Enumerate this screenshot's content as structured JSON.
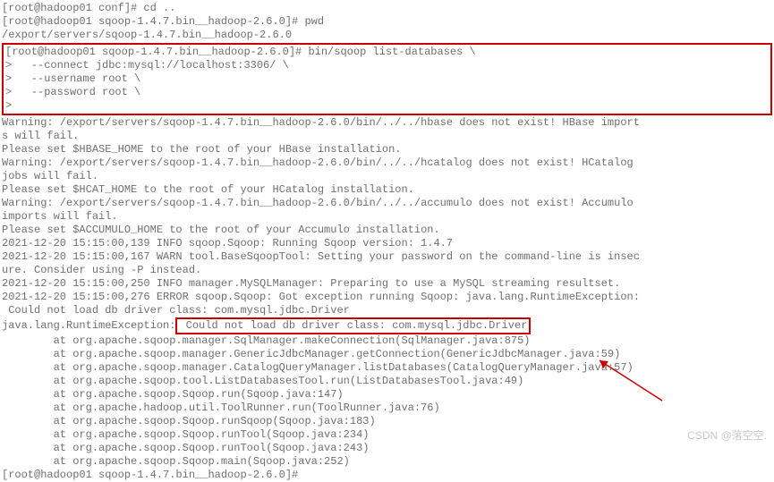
{
  "pre_lines": [
    "[root@hadoop01 conf]# cd ..",
    "[root@hadoop01 sqoop-1.4.7.bin__hadoop-2.6.0]# pwd",
    "/export/servers/sqoop-1.4.7.bin__hadoop-2.6.0"
  ],
  "boxed_command": [
    "[root@hadoop01 sqoop-1.4.7.bin__hadoop-2.6.0]# bin/sqoop list-databases \\",
    ">   --connect jdbc:mysql://localhost:3306/ \\",
    ">   --username root \\",
    ">   --password root \\",
    ">"
  ],
  "warn_lines": [
    "Warning: /export/servers/sqoop-1.4.7.bin__hadoop-2.6.0/bin/../../hbase does not exist! HBase import",
    "s will fail.",
    "Please set $HBASE_HOME to the root of your HBase installation.",
    "Warning: /export/servers/sqoop-1.4.7.bin__hadoop-2.6.0/bin/../../hcatalog does not exist! HCatalog ",
    "jobs will fail.",
    "Please set $HCAT_HOME to the root of your HCatalog installation.",
    "Warning: /export/servers/sqoop-1.4.7.bin__hadoop-2.6.0/bin/../../accumulo does not exist! Accumulo ",
    "imports will fail.",
    "Please set $ACCUMULO_HOME to the root of your Accumulo installation.",
    "2021-12-20 15:15:00,139 INFO sqoop.Sqoop: Running Sqoop version: 1.4.7",
    "2021-12-20 15:15:00,167 WARN tool.BaseSqoopTool: Setting your password on the command-line is insec",
    "ure. Consider using -P instead.",
    "2021-12-20 15:15:00,250 INFO manager.MySQLManager: Preparing to use a MySQL streaming resultset.",
    "2021-12-20 15:15:00,276 ERROR sqoop.Sqoop: Got exception running Sqoop: java.lang.RuntimeException:",
    " Could not load db driver class: com.mysql.jdbc.Driver"
  ],
  "exception_prefix": "java.lang.RuntimeException:",
  "exception_boxed": " Could not load db driver class: com.mysql.jdbc.Driver",
  "stack_lines": [
    "        at org.apache.sqoop.manager.SqlManager.makeConnection(SqlManager.java:875)",
    "        at org.apache.sqoop.manager.GenericJdbcManager.getConnection(GenericJdbcManager.java:59)",
    "        at org.apache.sqoop.manager.CatalogQueryManager.listDatabases(CatalogQueryManager.java:57)",
    "        at org.apache.sqoop.tool.ListDatabasesTool.run(ListDatabasesTool.java:49)",
    "        at org.apache.sqoop.Sqoop.run(Sqoop.java:147)",
    "        at org.apache.hadoop.util.ToolRunner.run(ToolRunner.java:76)",
    "        at org.apache.sqoop.Sqoop.runSqoop(Sqoop.java:183)",
    "        at org.apache.sqoop.Sqoop.runTool(Sqoop.java:234)",
    "        at org.apache.sqoop.Sqoop.runTool(Sqoop.java:243)",
    "        at org.apache.sqoop.Sqoop.main(Sqoop.java:252)"
  ],
  "final_prompt": "[root@hadoop01 sqoop-1.4.7.bin__hadoop-2.6.0]# ",
  "watermark": "CSDN @落空空."
}
